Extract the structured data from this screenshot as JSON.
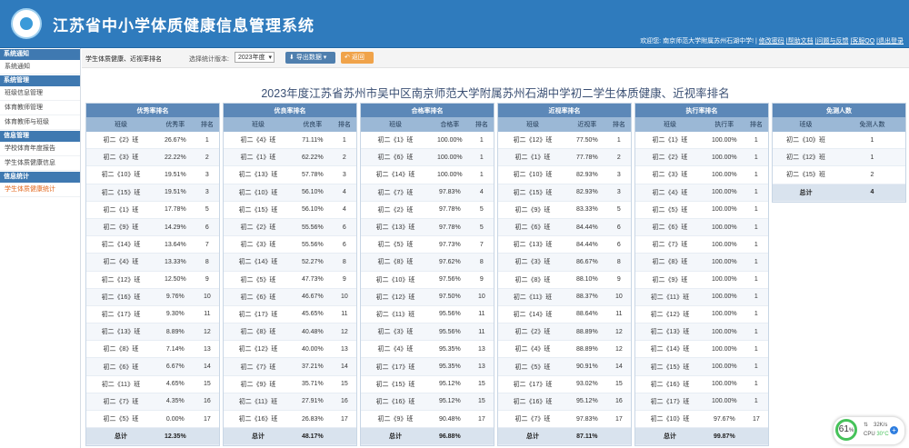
{
  "app": {
    "title": "江苏省中小学体质健康信息管理系统"
  },
  "user_bar": {
    "welcome": "欢迎您: 南京师范大学附属苏州石湖中学! |",
    "change_password": "修改密码",
    "help": "|帮助文档",
    "feedback": "|问题与反馈",
    "qq": "|客服QQ",
    "logout": "|退出登录"
  },
  "sidebar": {
    "sections": [
      {
        "title": "系统通知",
        "items": [
          {
            "label": "系统通知"
          }
        ]
      },
      {
        "title": "系统管理",
        "items": [
          {
            "label": "班级信息管理"
          },
          {
            "label": "体育教师管理"
          },
          {
            "label": "体育教师与班级"
          }
        ]
      },
      {
        "title": "信息管理",
        "items": [
          {
            "label": "学校体育年度报告"
          },
          {
            "label": "学生体质健康信息"
          }
        ]
      },
      {
        "title": "信息统计",
        "items": [
          {
            "label": "学生体质健康统计"
          }
        ]
      }
    ]
  },
  "toolbar": {
    "page_title": "学生体质健康、近视率排名",
    "version_label": "选择统计版本:",
    "version_value": "2023年度",
    "export_label": "导出数据",
    "back_label": "返回"
  },
  "main_title": "2023年度江苏省苏州市吴中区南京师范大学附属苏州石湖中学初二学生体质健康、近视率排名",
  "panels": [
    {
      "caption": "优秀率排名",
      "columns": [
        "班级",
        "优秀率",
        "排名"
      ],
      "rows": [
        [
          "初二《2》班",
          "26.67%",
          "1"
        ],
        [
          "初二《3》班",
          "22.22%",
          "2"
        ],
        [
          "初二《10》班",
          "19.51%",
          "3"
        ],
        [
          "初二《15》班",
          "19.51%",
          "3"
        ],
        [
          "初二《1》班",
          "17.78%",
          "5"
        ],
        [
          "初二《9》班",
          "14.29%",
          "6"
        ],
        [
          "初二《14》班",
          "13.64%",
          "7"
        ],
        [
          "初二《4》班",
          "13.33%",
          "8"
        ],
        [
          "初二《12》班",
          "12.50%",
          "9"
        ],
        [
          "初二《16》班",
          "9.76%",
          "10"
        ],
        [
          "初二《17》班",
          "9.30%",
          "11"
        ],
        [
          "初二《13》班",
          "8.89%",
          "12"
        ],
        [
          "初二《8》班",
          "7.14%",
          "13"
        ],
        [
          "初二《6》班",
          "6.67%",
          "14"
        ],
        [
          "初二《11》班",
          "4.65%",
          "15"
        ],
        [
          "初二《7》班",
          "4.35%",
          "16"
        ],
        [
          "初二《5》班",
          "0.00%",
          "17"
        ]
      ],
      "total": [
        "总计",
        "12.35%",
        ""
      ]
    },
    {
      "caption": "优良率排名",
      "columns": [
        "班级",
        "优良率",
        "排名"
      ],
      "rows": [
        [
          "初二《4》班",
          "71.11%",
          "1"
        ],
        [
          "初二《1》班",
          "62.22%",
          "2"
        ],
        [
          "初二《13》班",
          "57.78%",
          "3"
        ],
        [
          "初二《10》班",
          "56.10%",
          "4"
        ],
        [
          "初二《15》班",
          "56.10%",
          "4"
        ],
        [
          "初二《2》班",
          "55.56%",
          "6"
        ],
        [
          "初二《3》班",
          "55.56%",
          "6"
        ],
        [
          "初二《14》班",
          "52.27%",
          "8"
        ],
        [
          "初二《5》班",
          "47.73%",
          "9"
        ],
        [
          "初二《6》班",
          "46.67%",
          "10"
        ],
        [
          "初二《17》班",
          "45.65%",
          "11"
        ],
        [
          "初二《8》班",
          "40.48%",
          "12"
        ],
        [
          "初二《12》班",
          "40.00%",
          "13"
        ],
        [
          "初二《7》班",
          "37.21%",
          "14"
        ],
        [
          "初二《9》班",
          "35.71%",
          "15"
        ],
        [
          "初二《11》班",
          "27.91%",
          "16"
        ],
        [
          "初二《16》班",
          "26.83%",
          "17"
        ]
      ],
      "total": [
        "总计",
        "48.17%",
        ""
      ]
    },
    {
      "caption": "合格率排名",
      "columns": [
        "班级",
        "合格率",
        "排名"
      ],
      "rows": [
        [
          "初二《1》班",
          "100.00%",
          "1"
        ],
        [
          "初二《6》班",
          "100.00%",
          "1"
        ],
        [
          "初二《14》班",
          "100.00%",
          "1"
        ],
        [
          "初二《7》班",
          "97.83%",
          "4"
        ],
        [
          "初二《2》班",
          "97.78%",
          "5"
        ],
        [
          "初二《13》班",
          "97.78%",
          "5"
        ],
        [
          "初二《5》班",
          "97.73%",
          "7"
        ],
        [
          "初二《8》班",
          "97.62%",
          "8"
        ],
        [
          "初二《10》班",
          "97.56%",
          "9"
        ],
        [
          "初二《12》班",
          "97.50%",
          "10"
        ],
        [
          "初二《11》班",
          "95.56%",
          "11"
        ],
        [
          "初二《3》班",
          "95.56%",
          "11"
        ],
        [
          "初二《4》班",
          "95.35%",
          "13"
        ],
        [
          "初二《17》班",
          "95.35%",
          "13"
        ],
        [
          "初二《15》班",
          "95.12%",
          "15"
        ],
        [
          "初二《16》班",
          "95.12%",
          "15"
        ],
        [
          "初二《9》班",
          "90.48%",
          "17"
        ]
      ],
      "total": [
        "总计",
        "96.88%",
        ""
      ]
    },
    {
      "caption": "近视率排名",
      "columns": [
        "班级",
        "近视率",
        "排名"
      ],
      "rows": [
        [
          "初二《12》班",
          "77.50%",
          "1"
        ],
        [
          "初二《1》班",
          "77.78%",
          "2"
        ],
        [
          "初二《10》班",
          "82.93%",
          "3"
        ],
        [
          "初二《15》班",
          "82.93%",
          "3"
        ],
        [
          "初二《9》班",
          "83.33%",
          "5"
        ],
        [
          "初二《6》班",
          "84.44%",
          "6"
        ],
        [
          "初二《13》班",
          "84.44%",
          "6"
        ],
        [
          "初二《3》班",
          "86.67%",
          "8"
        ],
        [
          "初二《8》班",
          "88.10%",
          "9"
        ],
        [
          "初二《11》班",
          "88.37%",
          "10"
        ],
        [
          "初二《14》班",
          "88.64%",
          "11"
        ],
        [
          "初二《2》班",
          "88.89%",
          "12"
        ],
        [
          "初二《4》班",
          "88.89%",
          "12"
        ],
        [
          "初二《5》班",
          "90.91%",
          "14"
        ],
        [
          "初二《17》班",
          "93.02%",
          "15"
        ],
        [
          "初二《16》班",
          "95.12%",
          "16"
        ],
        [
          "初二《7》班",
          "97.83%",
          "17"
        ]
      ],
      "total": [
        "总计",
        "87.11%",
        ""
      ]
    },
    {
      "caption": "执行率排名",
      "columns": [
        "班级",
        "执行率",
        "排名"
      ],
      "rows": [
        [
          "初二《1》班",
          "100.00%",
          "1"
        ],
        [
          "初二《2》班",
          "100.00%",
          "1"
        ],
        [
          "初二《3》班",
          "100.00%",
          "1"
        ],
        [
          "初二《4》班",
          "100.00%",
          "1"
        ],
        [
          "初二《5》班",
          "100.00%",
          "1"
        ],
        [
          "初二《6》班",
          "100.00%",
          "1"
        ],
        [
          "初二《7》班",
          "100.00%",
          "1"
        ],
        [
          "初二《8》班",
          "100.00%",
          "1"
        ],
        [
          "初二《9》班",
          "100.00%",
          "1"
        ],
        [
          "初二《11》班",
          "100.00%",
          "1"
        ],
        [
          "初二《12》班",
          "100.00%",
          "1"
        ],
        [
          "初二《13》班",
          "100.00%",
          "1"
        ],
        [
          "初二《14》班",
          "100.00%",
          "1"
        ],
        [
          "初二《15》班",
          "100.00%",
          "1"
        ],
        [
          "初二《16》班",
          "100.00%",
          "1"
        ],
        [
          "初二《17》班",
          "100.00%",
          "1"
        ],
        [
          "初二《10》班",
          "97.67%",
          "17"
        ]
      ],
      "total": [
        "总计",
        "99.87%",
        ""
      ]
    },
    {
      "caption": "免测人数",
      "columns": [
        "班级",
        "免测人数"
      ],
      "rows": [
        [
          "初二《10》班",
          "1"
        ],
        [
          "初二《12》班",
          "1"
        ],
        [
          "初二《15》班",
          "2"
        ]
      ],
      "total": [
        "总计",
        "4"
      ]
    }
  ],
  "cpu_widget": {
    "percent": "61",
    "percent_unit": "%",
    "net": "32K/s",
    "cpu_label": "CPU",
    "temp": "30°C"
  }
}
